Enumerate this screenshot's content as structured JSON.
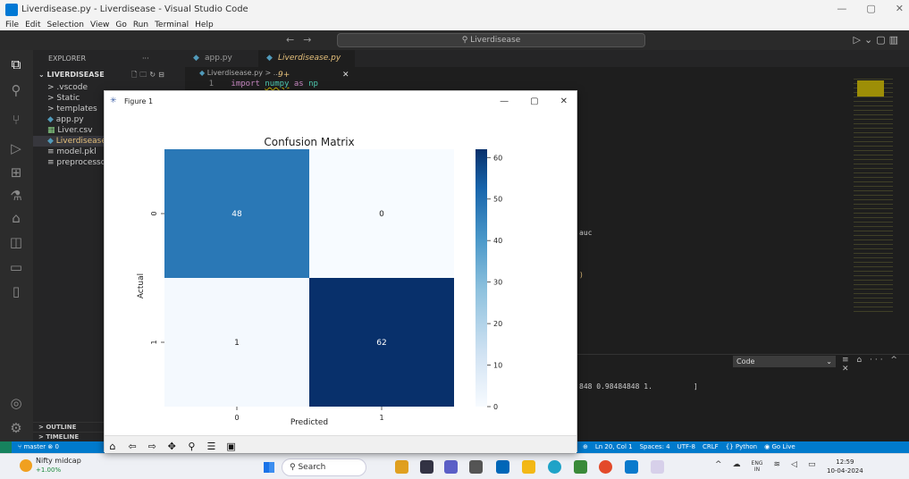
{
  "window": {
    "title": "Liverdisease.py - Liverdisease - Visual Studio Code",
    "controls": [
      "—",
      "▢",
      "✕"
    ]
  },
  "menu": [
    "File",
    "Edit",
    "Selection",
    "View",
    "Go",
    "Run",
    "Terminal",
    "Help"
  ],
  "commandbar": {
    "search": "Liverdisease"
  },
  "explorer": {
    "header": "EXPLORER",
    "header_more": "···",
    "folder": "LIVERDISEASE",
    "items": [
      {
        "label": "> .vscode"
      },
      {
        "label": "> Static"
      },
      {
        "label": "> templates"
      },
      {
        "label": "app.py"
      },
      {
        "label": "Liver.csv"
      },
      {
        "label": "Liverdisease.py"
      },
      {
        "label": "model.pkl"
      },
      {
        "label": "preprocessor.pkl"
      }
    ],
    "outline": "OUTLINE",
    "timeline": "TIMELINE"
  },
  "editor": {
    "tabs": [
      {
        "label": "app.py"
      },
      {
        "label": "Liverdisease.py 9+"
      }
    ],
    "breadcrumb": "Liverdisease.py > ...",
    "line_no": "1",
    "code_keyword": "import",
    "code_module": "numpy",
    "code_as": "as",
    "code_alias": "np",
    "frag_auc": "auc",
    "frag_paren": ")",
    "terminal_line": "848 0.98484848 1.",
    "terminal_bracket": "]"
  },
  "panel": {
    "dropdown": "Code"
  },
  "statusbar": {
    "branch": "master",
    "errors": "⊗ 0",
    "position": "Ln 20, Col 1",
    "spaces": "Spaces: 4",
    "encoding": "UTF-8",
    "eol": "CRLF",
    "language": "Python",
    "golive": "Go Live"
  },
  "taskbar": {
    "news_title": "Nifty midcap",
    "news_value": "+1.00%",
    "search": "Search",
    "lang_top": "ENG",
    "lang_bottom": "IN",
    "time": "12:59",
    "date": "10-04-2024"
  },
  "figure": {
    "title": "Figure 1",
    "toolbar_icons": [
      "home-icon",
      "back-icon",
      "forward-icon",
      "pan-icon",
      "zoom-icon",
      "settings-icon",
      "save-icon"
    ]
  },
  "chart_data": {
    "type": "heatmap",
    "title": "Confusion Matrix",
    "xlabel": "Predicted",
    "ylabel": "Actual",
    "x_categories": [
      "0",
      "1"
    ],
    "y_categories": [
      "0",
      "1"
    ],
    "values": [
      [
        48,
        0
      ],
      [
        1,
        62
      ]
    ],
    "colorbar": {
      "min": 0,
      "max": 62,
      "ticks": [
        0,
        10,
        20,
        30,
        40,
        50,
        60
      ]
    },
    "colormap": "Blues",
    "low_color": "#f7fbff",
    "high_color": "#08306b"
  }
}
